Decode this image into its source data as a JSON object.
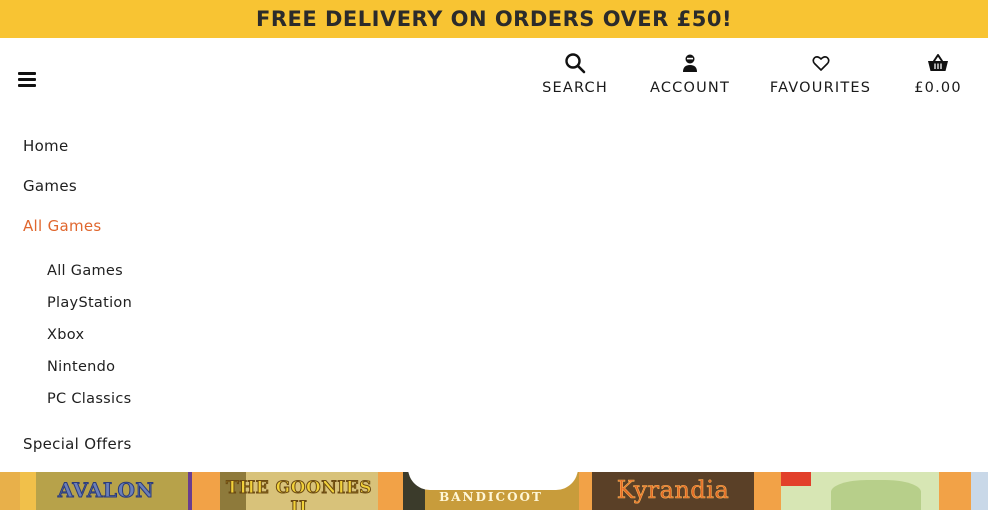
{
  "promo": {
    "text": "FREE DELIVERY ON ORDERS OVER £50!"
  },
  "header": {
    "actions": [
      {
        "label": "SEARCH",
        "icon": "search-icon"
      },
      {
        "label": "ACCOUNT",
        "icon": "account-icon"
      },
      {
        "label": "FAVOURITES",
        "icon": "heart-icon"
      },
      {
        "label": "£0.00",
        "icon": "basket-icon"
      }
    ]
  },
  "menu": {
    "items": [
      "Home",
      "Games",
      "All Games",
      "Special Offers"
    ],
    "sub_items": [
      "All Games",
      "PlayStation",
      "Xbox",
      "Nintendo",
      "PC Classics"
    ]
  },
  "strip": {
    "tiles": [
      {
        "title": "AVALON"
      },
      {
        "title": "THE GOONIES II"
      },
      {
        "title": "BANDICOOT"
      },
      {
        "title": "Kyrandia"
      },
      {
        "title": ""
      }
    ]
  },
  "colors": {
    "promo_bg": "#f8c433",
    "active_menu": "#e0672e",
    "text": "#1a1a1a"
  }
}
